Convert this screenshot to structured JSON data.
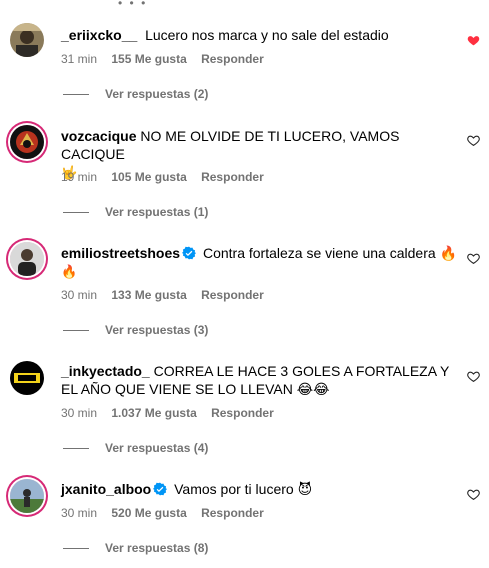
{
  "comments": [
    {
      "username": "_eriixcko__",
      "verified": false,
      "text": "Lucero nos marca y no sale del estadio",
      "emoji_line": "",
      "time": "31 min",
      "likes": "155 Me gusta",
      "reply": "Responder",
      "view_replies": "Ver respuestas (2)",
      "liked": true
    },
    {
      "username": "vozcacique",
      "verified": false,
      "text": "NO ME OLVIDE DE TI LUCERO, VAMOS CACIQUE",
      "emoji_line": "🤟",
      "time": "19 min",
      "likes": "105 Me gusta",
      "reply": "Responder",
      "view_replies": "Ver respuestas (1)",
      "liked": false
    },
    {
      "username": "emiliostreetshoes",
      "verified": true,
      "text": "Contra fortaleza se viene una caldera 🔥",
      "emoji_line": "🔥",
      "time": "30 min",
      "likes": "133 Me gusta",
      "reply": "Responder",
      "view_replies": "Ver respuestas (3)",
      "liked": false
    },
    {
      "username": "_inkyectado_",
      "verified": false,
      "text": "CORREA LE HACE 3 GOLES A FORTALEZA Y EL AÑO QUE VIENE SE LO LLEVAN 😂😂",
      "emoji_line": "",
      "time": "30 min",
      "likes": "1.037 Me gusta",
      "reply": "Responder",
      "view_replies": "Ver respuestas (4)",
      "liked": false
    },
    {
      "username": "jxanito_alboo",
      "verified": true,
      "text": "Vamos por ti lucero 😈",
      "emoji_line": "",
      "time": "30 min",
      "likes": "520 Me gusta",
      "reply": "Responder",
      "view_replies": "Ver respuestas (8)",
      "liked": false
    }
  ],
  "colors": {
    "like_red": "#ff3040",
    "meta_gray": "#737373",
    "verified_blue": "#0095f6"
  },
  "icons": {
    "heart": "heart-icon",
    "verified": "verified-badge-icon"
  }
}
